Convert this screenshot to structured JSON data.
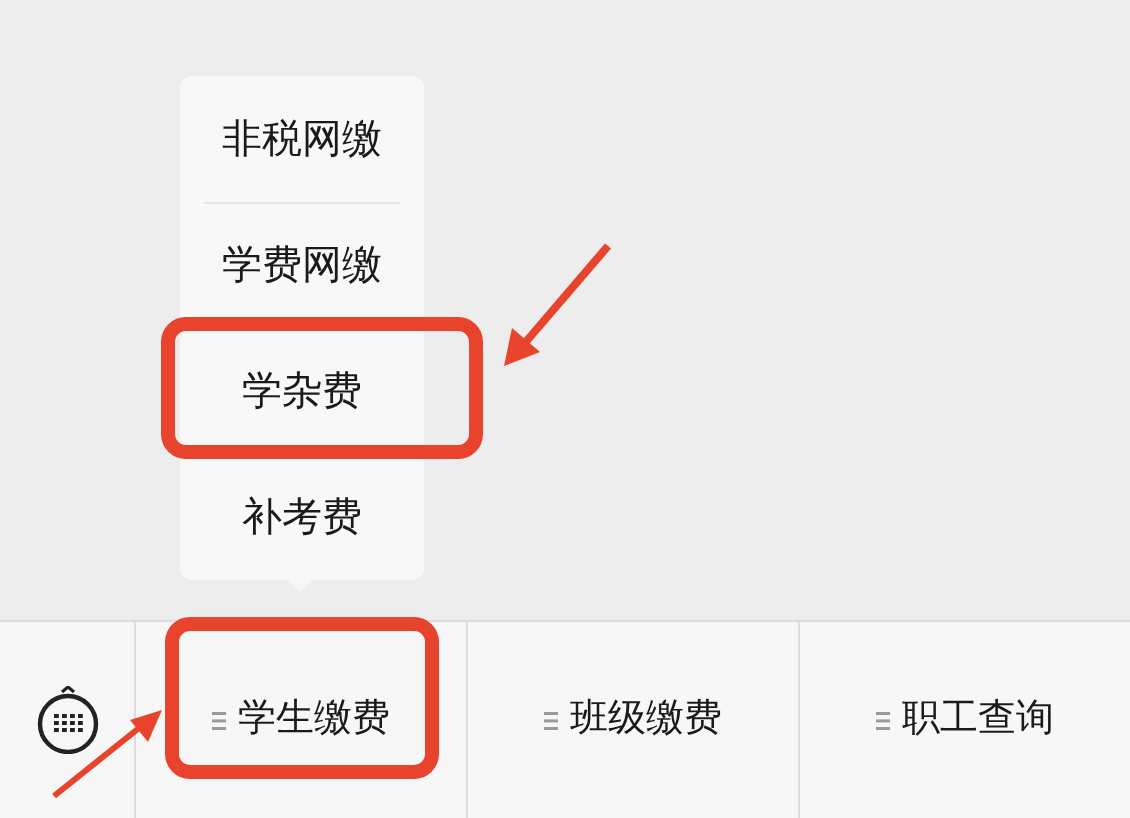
{
  "popup_menu": {
    "items": [
      {
        "label": "非税网缴"
      },
      {
        "label": "学费网缴"
      },
      {
        "label": "学杂费"
      },
      {
        "label": "补考费"
      }
    ]
  },
  "bottom_menu": {
    "tabs": [
      {
        "label": "学生缴费"
      },
      {
        "label": "班级缴费"
      },
      {
        "label": "职工查询"
      }
    ]
  }
}
